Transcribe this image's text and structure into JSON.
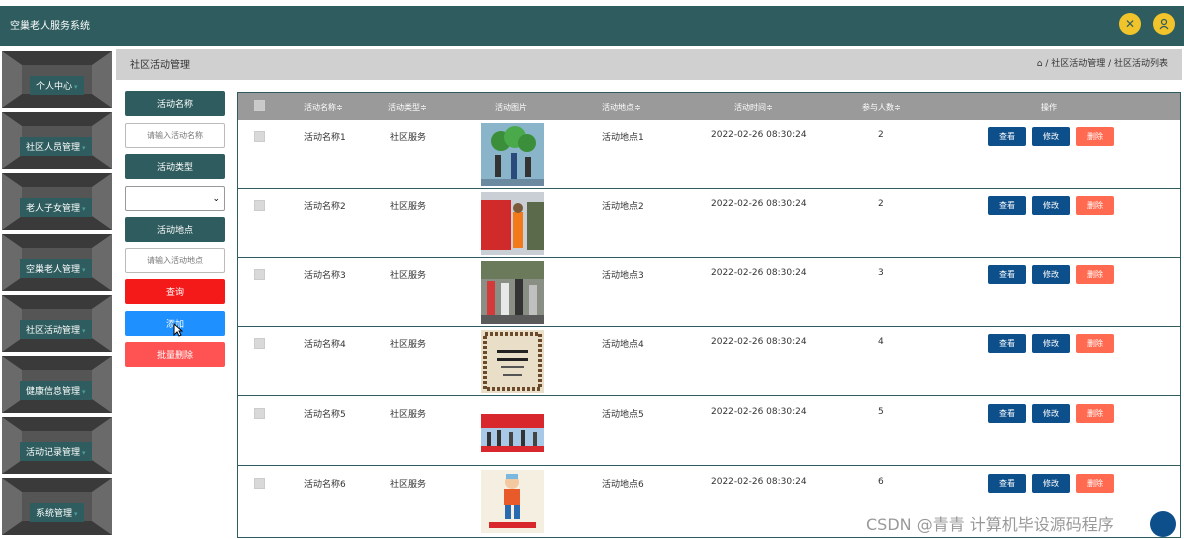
{
  "app": {
    "title": "空巢老人服务系统"
  },
  "topbar": {
    "icons": [
      "fullscreen-icon",
      "user-icon"
    ],
    "accent": "#f0c42a",
    "bg": "#2f5d5f"
  },
  "sidebar": {
    "items": [
      {
        "label": "个人中心"
      },
      {
        "label": "社区人员管理"
      },
      {
        "label": "老人子女管理"
      },
      {
        "label": "空巢老人管理"
      },
      {
        "label": "社区活动管理"
      },
      {
        "label": "健康信息管理"
      },
      {
        "label": "活动记录管理"
      },
      {
        "label": "系统管理"
      }
    ]
  },
  "page": {
    "title": "社区活动管理",
    "breadcrumb": "社区活动管理 / 社区活动列表"
  },
  "filters": {
    "name_label": "活动名称",
    "name_placeholder": "请输入活动名称",
    "type_label": "活动类型",
    "type_value": "",
    "place_label": "活动地点",
    "place_placeholder": "请输入活动地点",
    "query": "查询",
    "add": "添加",
    "batch_delete": "批量删除"
  },
  "table": {
    "headers": [
      "活动名称≑",
      "活动类型≑",
      "活动图片",
      "活动地点≑",
      "活动时间≑",
      "参与人数≑",
      "操作"
    ],
    "rows": [
      {
        "name": "活动名称1",
        "type": "社区服务",
        "place": "活动地点1",
        "time": "2022-02-26 08:30:24",
        "count": "2"
      },
      {
        "name": "活动名称2",
        "type": "社区服务",
        "place": "活动地点2",
        "time": "2022-02-26 08:30:24",
        "count": "2"
      },
      {
        "name": "活动名称3",
        "type": "社区服务",
        "place": "活动地点3",
        "time": "2022-02-26 08:30:24",
        "count": "3"
      },
      {
        "name": "活动名称4",
        "type": "社区服务",
        "place": "活动地点4",
        "time": "2022-02-26 08:30:24",
        "count": "4"
      },
      {
        "name": "活动名称5",
        "type": "社区服务",
        "place": "活动地点5",
        "time": "2022-02-26 08:30:24",
        "count": "5"
      },
      {
        "name": "活动名称6",
        "type": "社区服务",
        "place": "活动地点6",
        "time": "2022-02-26 08:30:24",
        "count": "6"
      }
    ],
    "actions": {
      "view": "查看",
      "edit": "修改",
      "delete": "删除"
    }
  },
  "watermark": "CSDN @青青  计算机毕设源码程序"
}
